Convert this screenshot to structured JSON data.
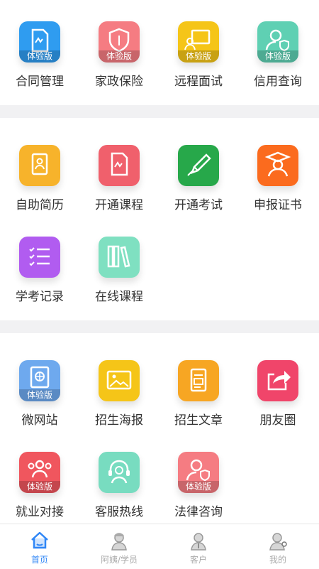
{
  "section1": {
    "items": [
      {
        "label": "合同管理",
        "badge": "体验版",
        "color": "#2f9cf0",
        "icon": "contract-icon"
      },
      {
        "label": "家政保险",
        "badge": "体验版",
        "color": "#f57c82",
        "icon": "shield-icon"
      },
      {
        "label": "远程面试",
        "badge": "体验版",
        "color": "#f5c518",
        "icon": "video-interview-icon"
      },
      {
        "label": "信用查询",
        "badge": "体验版",
        "color": "#5fd0b3",
        "icon": "credit-user-icon"
      }
    ]
  },
  "section2": {
    "items": [
      {
        "label": "自助简历",
        "color": "#f7b32b",
        "icon": "resume-icon"
      },
      {
        "label": "开通课程",
        "color": "#f0606c",
        "icon": "course-icon"
      },
      {
        "label": "开通考试",
        "color": "#27a84a",
        "icon": "pen-icon"
      },
      {
        "label": "申报证书",
        "color": "#fb6b1e",
        "icon": "graduate-icon"
      },
      {
        "label": "学考记录",
        "color": "#b15cf0",
        "icon": "checklist-icon"
      },
      {
        "label": "在线课程",
        "color": "#7fe0c1",
        "icon": "books-icon"
      }
    ]
  },
  "section3": {
    "items": [
      {
        "label": "微网站",
        "badge": "体验版",
        "color": "#6ea9ee",
        "icon": "globe-icon"
      },
      {
        "label": "招生海报",
        "color": "#f5c518",
        "icon": "image-icon"
      },
      {
        "label": "招生文章",
        "color": "#f7a623",
        "icon": "document-icon"
      },
      {
        "label": "朋友圈",
        "color": "#f0456a",
        "icon": "share-icon"
      },
      {
        "label": "就业对接",
        "badge": "体验版",
        "color": "#f0565e",
        "icon": "team-icon"
      },
      {
        "label": "客服热线",
        "color": "#78dcc0",
        "icon": "headset-icon"
      },
      {
        "label": "法律咨询",
        "badge": "体验版",
        "color": "#f57c82",
        "icon": "legal-user-icon"
      }
    ]
  },
  "tabbar": {
    "tabs": [
      {
        "label": "首页",
        "icon": "home-icon",
        "active": true
      },
      {
        "label": "阿姨/学员",
        "icon": "nanny-icon",
        "active": false
      },
      {
        "label": "客户",
        "icon": "customer-icon",
        "active": false
      },
      {
        "label": "我的",
        "icon": "profile-icon",
        "active": false
      }
    ],
    "active_color": "#2f86f6",
    "inactive_color": "#aaaaaa"
  }
}
